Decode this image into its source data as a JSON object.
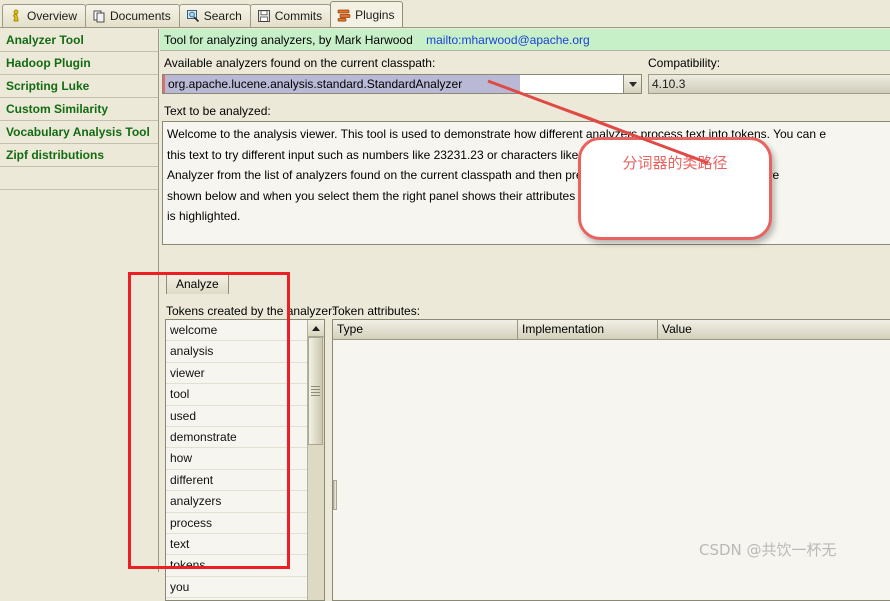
{
  "tabs": [
    {
      "label": "Overview",
      "icon": "person-icon",
      "active": false
    },
    {
      "label": "Documents",
      "icon": "documents-icon",
      "active": false
    },
    {
      "label": "Search",
      "icon": "search-icon",
      "active": false
    },
    {
      "label": "Commits",
      "icon": "floppy-disk-icon",
      "active": false
    },
    {
      "label": "Plugins",
      "icon": "plugins-icon",
      "active": true
    }
  ],
  "sidebar": {
    "items": [
      {
        "label": "Analyzer Tool"
      },
      {
        "label": "Hadoop Plugin"
      },
      {
        "label": "Scripting Luke"
      },
      {
        "label": "Custom Similarity"
      },
      {
        "label": "Vocabulary Analysis Tool"
      },
      {
        "label": "Zipf distributions"
      }
    ]
  },
  "banner": {
    "text": "Tool for analyzing analyzers, by Mark Harwood",
    "mail": "mailto:mharwood@apache.org"
  },
  "analyzer": {
    "available_label": "Available analyzers found on the current classpath:",
    "selected": "org.apache.lucene.analysis.standard.StandardAnalyzer",
    "compatibility_label": "Compatibility:",
    "compatibility_value": "4.10.3"
  },
  "text_panel": {
    "label": "Text to be analyzed:",
    "lines": [
      "Welcome to the analysis viewer. This tool is used to demonstrate how different analyzers process text into tokens. You can e",
      "this text to try different input such as numbers like 23231.23 or characters like &^%$£. Once happy, select an",
      "Analyzer from the list of analyzers found on the current classpath and then press analyze. The tokens produced are",
      "shown below and when you select them the right panel shows their attributes and their position in the original tex",
      "is highlighted."
    ]
  },
  "actions": {
    "analyze_label": "Analyze"
  },
  "tokens_panel": {
    "label": "Tokens created by the analyzer:",
    "tokens": [
      "welcome",
      "analysis",
      "viewer",
      "tool",
      "used",
      "demonstrate",
      "how",
      "different",
      "analyzers",
      "process",
      "text",
      "tokens",
      "you"
    ]
  },
  "attributes_panel": {
    "label": "Token attributes:",
    "columns": [
      "Type",
      "Implementation",
      "Value"
    ],
    "rows": []
  },
  "annotations": {
    "callout_text": "分词器的类路径",
    "callout_color": "#e8635f",
    "highlight_box_color": "#ec2024",
    "watermark": "CSDN @共饮一杯无"
  }
}
